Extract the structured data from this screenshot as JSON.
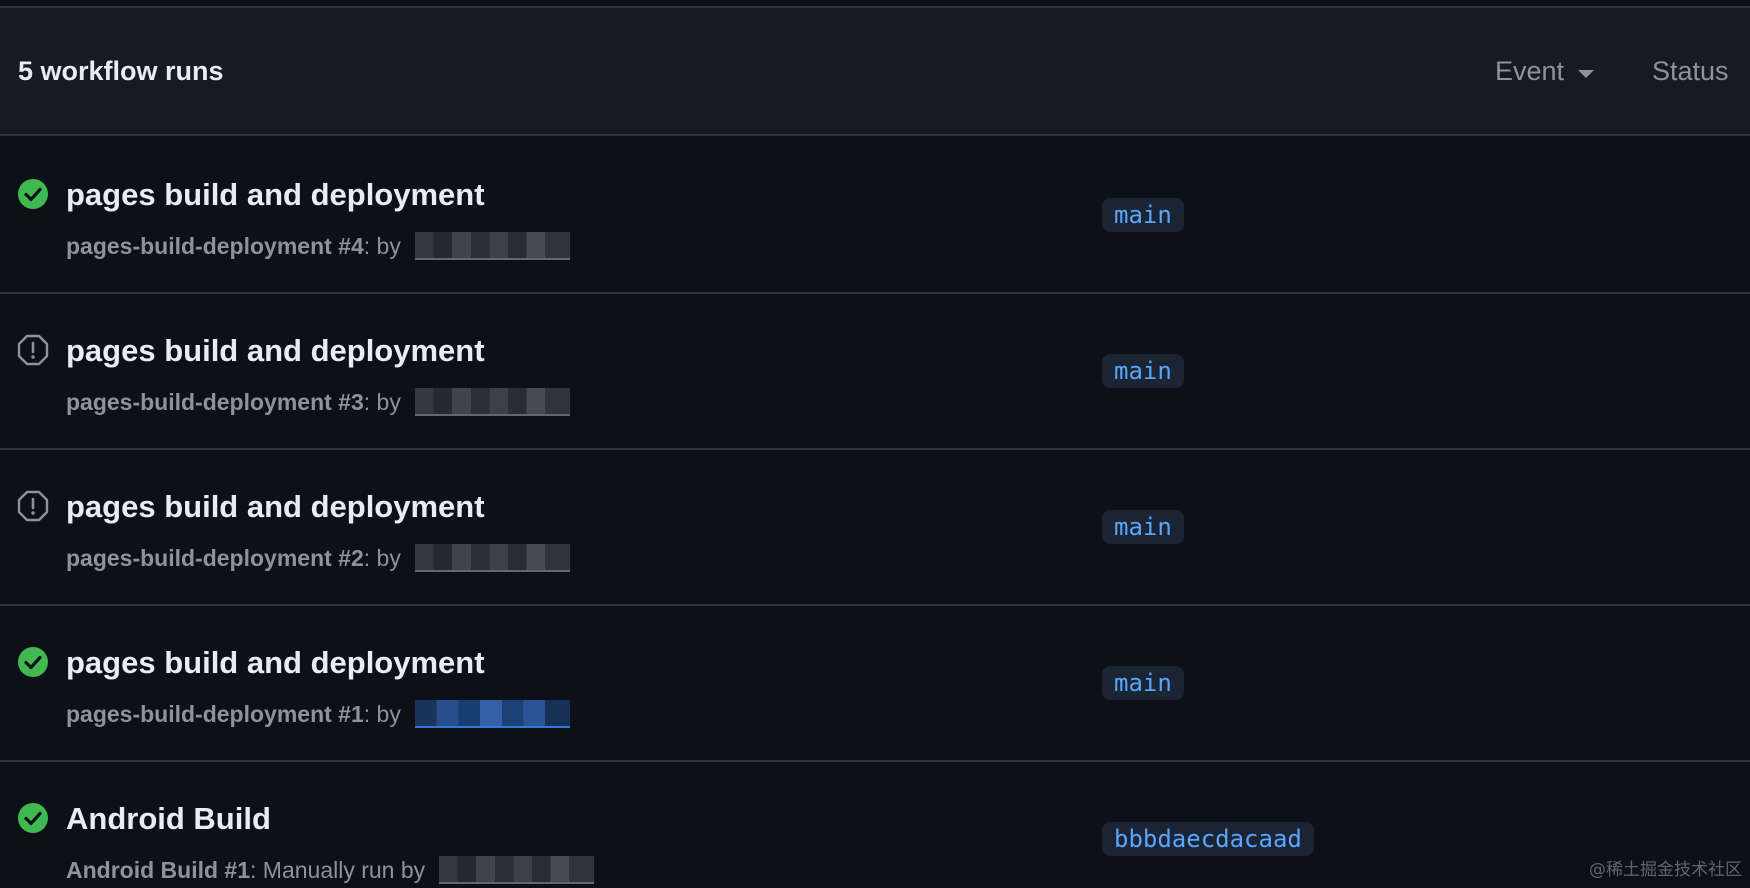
{
  "header": {
    "count_label": "5 workflow runs",
    "filters": {
      "event": "Event",
      "status": "Status"
    }
  },
  "runs": [
    {
      "title": "pages build and deployment",
      "workflow": "pages-build-deployment #4",
      "trigger": ": by",
      "status": "success",
      "status_icon": "check-circle-icon",
      "branch": "main"
    },
    {
      "title": "pages build and deployment",
      "workflow": "pages-build-deployment #3",
      "trigger": ": by",
      "status": "error",
      "status_icon": "alert-octagon-icon",
      "branch": "main"
    },
    {
      "title": "pages build and deployment",
      "workflow": "pages-build-deployment #2",
      "trigger": ": by",
      "status": "error",
      "status_icon": "alert-octagon-icon",
      "branch": "main"
    },
    {
      "title": "pages build and deployment",
      "workflow": "pages-build-deployment #1",
      "trigger": ": by",
      "status": "success",
      "status_icon": "check-circle-icon",
      "branch": "main"
    },
    {
      "title": "Android Build",
      "workflow": "Android Build #1",
      "trigger": ": Manually run by",
      "status": "success",
      "status_icon": "check-circle-icon",
      "branch": "bbbdaecdacaad"
    }
  ],
  "watermark": "@稀土掘金技术社区",
  "colors": {
    "background": "#0d1117",
    "header_background": "#161b22",
    "border": "#30363d",
    "success": "#3fb950",
    "error_icon": "#8b949e",
    "branch_text": "#58a6ff",
    "branch_background": "#1b2433"
  }
}
